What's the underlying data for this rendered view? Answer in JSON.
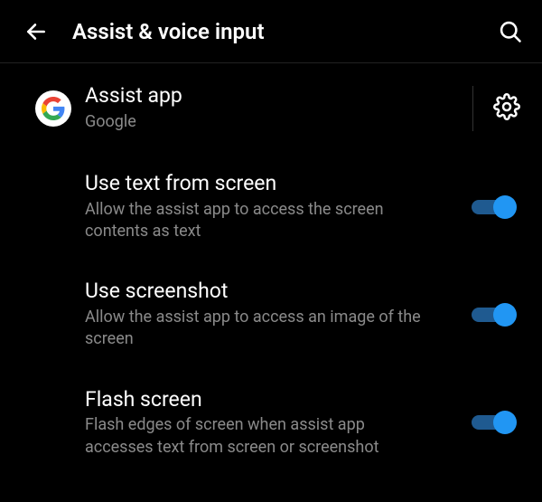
{
  "header": {
    "title": "Assist & voice input"
  },
  "assist_app": {
    "title": "Assist app",
    "subtitle": "Google"
  },
  "items": [
    {
      "title": "Use text from screen",
      "subtitle": "Allow the assist app to access the screen contents as text",
      "enabled": true
    },
    {
      "title": "Use screenshot",
      "subtitle": "Allow the assist app to access an image of the screen",
      "enabled": true
    },
    {
      "title": "Flash screen",
      "subtitle": "Flash edges of screen when assist app accesses text from screen or screenshot",
      "enabled": true
    }
  ],
  "colors": {
    "accent": "#2196f3"
  }
}
